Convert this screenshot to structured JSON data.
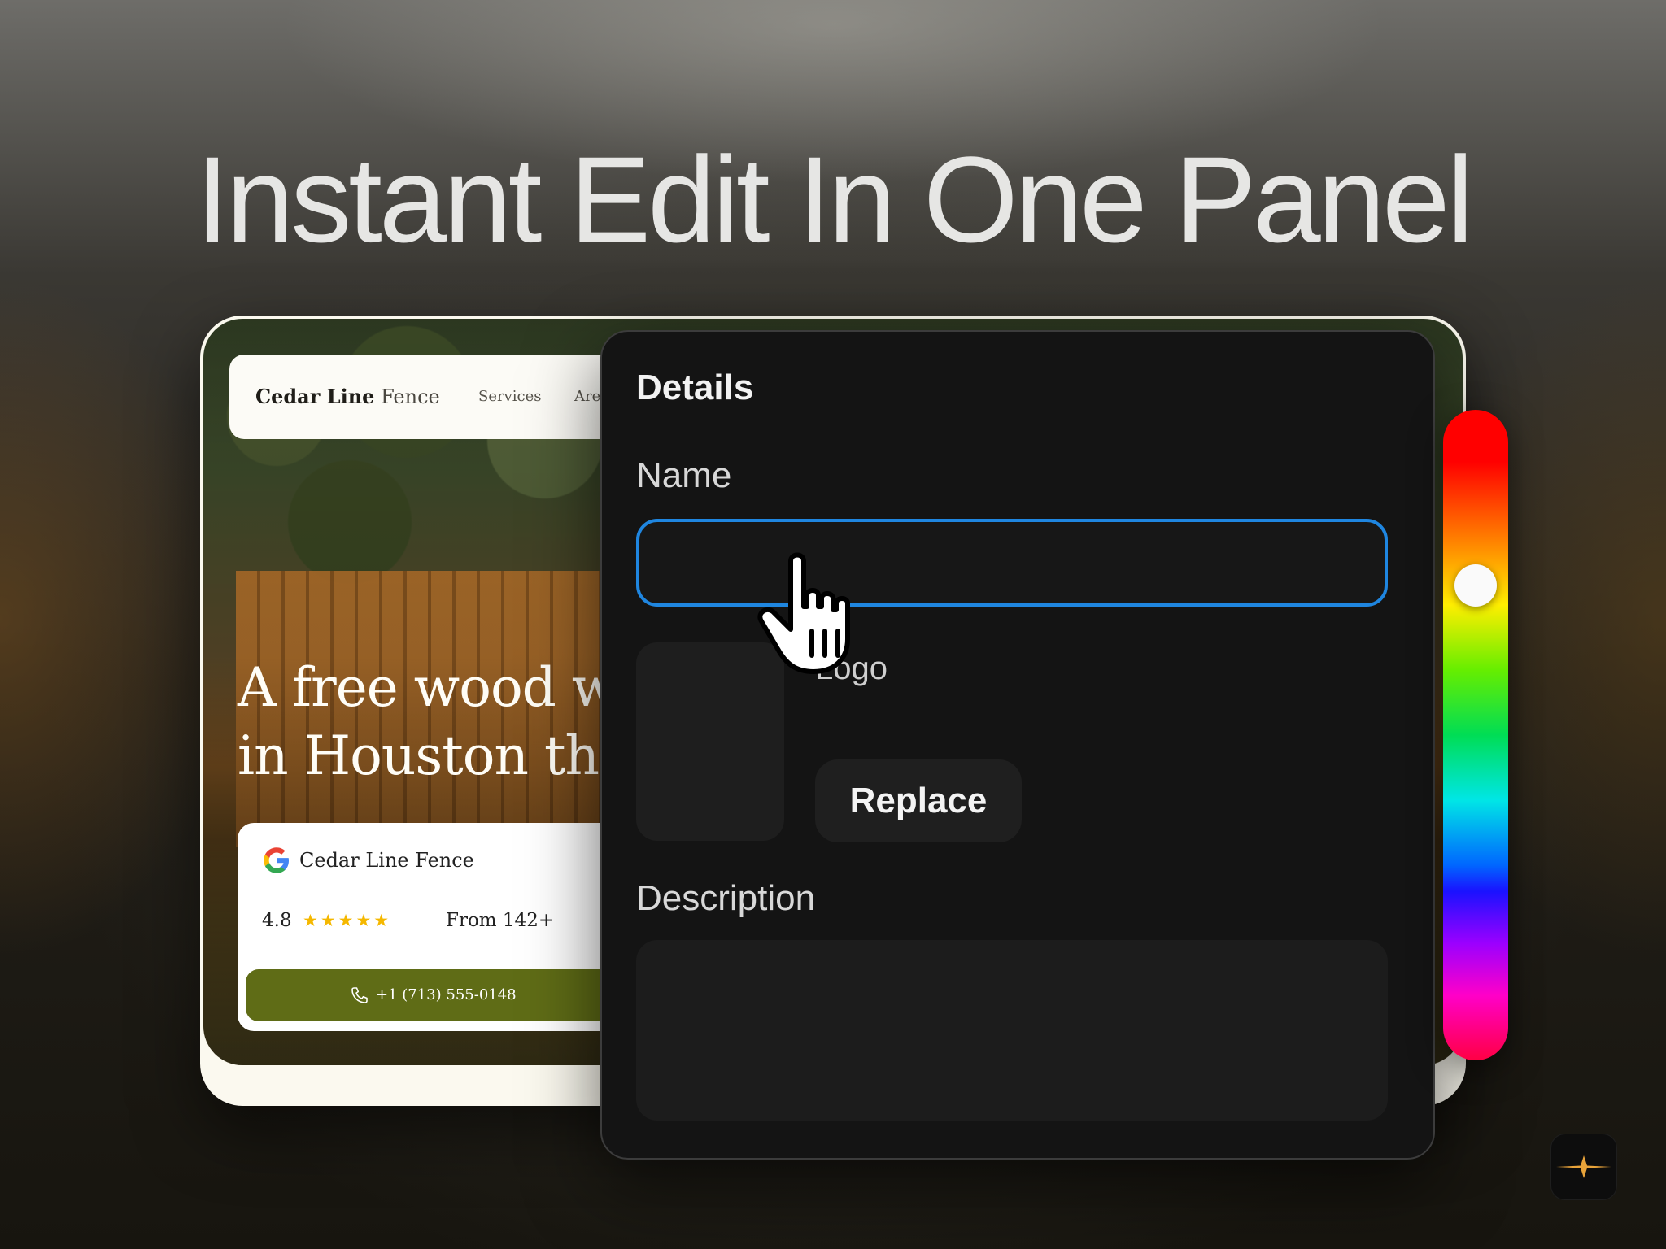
{
  "headline": "Instant Edit In One Panel",
  "website": {
    "brand_bold": "Cedar Line",
    "brand_light": "Fence",
    "nav": [
      "Services",
      "Are"
    ],
    "hero_line1": "A free wood w",
    "hero_line2": "in Houston thi",
    "review_card": {
      "name": "Cedar Line Fence",
      "rating": "4.8",
      "stars": "★★★★★",
      "reviews_text": "From 142+"
    },
    "call_button": "+1 (713) 555-0148"
  },
  "panel": {
    "title": "Details",
    "name_label": "Name",
    "name_value": "",
    "logo_label": "Logo",
    "replace_button": "Replace",
    "description_label": "Description",
    "description_value": ""
  },
  "hue_slider": {
    "value_fraction": 0.27
  },
  "colors": {
    "accent_blue": "#1f86e0",
    "panel_bg": "#141414",
    "call_button_green": "#5f6c16",
    "star_yellow": "#f5b800"
  },
  "icons": [
    "google-icon",
    "phone-icon",
    "hand-pointer-icon",
    "sparkle-icon"
  ]
}
